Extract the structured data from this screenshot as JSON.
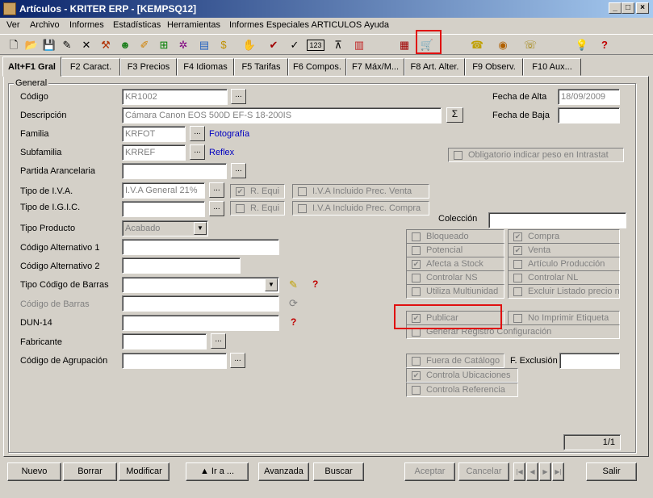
{
  "window": {
    "title": "Artículos - KRITER ERP - [KEMPSQ12]",
    "min": "_",
    "max": "□",
    "close": "×"
  },
  "menu": [
    "Ver",
    "Archivo",
    "Informes",
    "Estadísticas",
    "Herramientas",
    "Informes Especiales ARTICULOS",
    "Ayuda"
  ],
  "toolbar_icons": {
    "new": "🗋",
    "open": "📂",
    "save": "💾",
    "edit": "✎",
    "delete": "✕",
    "tools": "⚒",
    "user": "☻",
    "pencil": "✐",
    "tree": "⊞",
    "network": "✲",
    "books": "▤",
    "money": "$",
    "hand": "✋",
    "tag": "✔",
    "check": "✓",
    "num": "123",
    "filter": "⊼",
    "chart": "▥",
    "doc": "▦",
    "cart": "🛒",
    "phone": "☎",
    "bag": "◉",
    "tel": "☏",
    "bulb": "💡",
    "help": "?"
  },
  "tabs": [
    "Alt+F1 Gral",
    "F2 Caract.",
    "F3 Precios",
    "F4 Idiomas",
    "F5 Tarifas",
    "F6 Compos.",
    "F7 Máx/M...",
    "F8 Art. Alter.",
    "F9 Observ.",
    "F10 Aux..."
  ],
  "group_title": "General",
  "labels": {
    "codigo": "Código",
    "descripcion": "Descripción",
    "familia": "Familia",
    "subfamilia": "Subfamilia",
    "partida": "Partida Arancelaria",
    "tipo_iva": "Tipo de I.V.A.",
    "tipo_igic": "Tipo de I.G.I.C.",
    "tipo_producto": "Tipo Producto",
    "cod_alt1": "Código Alternativo 1",
    "cod_alt2": "Código Alternativo 2",
    "tipo_cod_barras": "Tipo Código de Barras",
    "cod_barras": "Código de Barras",
    "dun14": "DUN-14",
    "fabricante": "Fabricante",
    "cod_agrupacion": "Código de Agrupación",
    "fecha_alta": "Fecha de Alta",
    "fecha_baja": "Fecha de Baja",
    "coleccion": "Colección",
    "f_exclusion": "F. Exclusión"
  },
  "values": {
    "codigo": "KR1002",
    "descripcion": "Cámara Canon EOS 500D EF-S 18-200IS",
    "familia": "KRFOT",
    "familia_desc": "Fotografía",
    "subfamilia": "KRREF",
    "subfamilia_desc": "Reflex",
    "tipo_iva": "I.V.A General 21%",
    "tipo_producto": "Acabado",
    "fecha_alta": "18/09/2009",
    "fecha_baja": "",
    "coleccion": "",
    "f_exclusion": "",
    "record": "1/1"
  },
  "dots": "...",
  "sigma": "Σ",
  "checks": {
    "obligatorio_peso": {
      "label": "Obligatorio indicar peso en Intrastat",
      "checked": false
    },
    "r_equi": {
      "label": "R. Equi",
      "checked": true
    },
    "iva_incl_venta": {
      "label": "I.V.A Incluido Prec. Venta",
      "checked": false
    },
    "r_equi2": {
      "label": "R. Equi",
      "checked": false
    },
    "iva_incl_compra": {
      "label": "I.V.A Incluido Prec. Compra",
      "checked": false
    },
    "bloqueado": {
      "label": "Bloqueado",
      "checked": false
    },
    "compra": {
      "label": "Compra",
      "checked": true
    },
    "potencial": {
      "label": "Potencial",
      "checked": false
    },
    "venta": {
      "label": "Venta",
      "checked": true
    },
    "afecta_stock": {
      "label": "Afecta a Stock",
      "checked": true
    },
    "articulo_produccion": {
      "label": "Artículo Producción",
      "checked": false
    },
    "controlar_ns": {
      "label": "Controlar NS",
      "checked": false
    },
    "controlar_nl": {
      "label": "Controlar NL",
      "checked": false
    },
    "multiunidad": {
      "label": "Utiliza Multiunidad",
      "checked": false
    },
    "excluir_listado": {
      "label": "Excluir Listado precio n",
      "checked": false
    },
    "publicar": {
      "label": "Publicar",
      "checked": true
    },
    "no_imprimir": {
      "label": "No Imprimir Etiqueta",
      "checked": false
    },
    "generar_registro": {
      "label": "Generar Registro Configuración",
      "checked": false
    },
    "fuera_catalogo": {
      "label": "Fuera de Catálogo",
      "checked": false
    },
    "controla_ubicaciones": {
      "label": "Controla Ubicaciones",
      "checked": true
    },
    "controla_referencia": {
      "label": "Controla Referencia",
      "checked": false
    }
  },
  "buttons": {
    "nuevo": "Nuevo",
    "borrar": "Borrar",
    "modificar": "Modificar",
    "ira": "▲ Ir a ...",
    "avanzada": "Avanzada",
    "buscar": "Buscar",
    "aceptar": "Aceptar",
    "cancelar": "Cancelar",
    "salir": "Salir"
  },
  "nav": [
    "|◀",
    "◀",
    "▶",
    "▶|"
  ]
}
